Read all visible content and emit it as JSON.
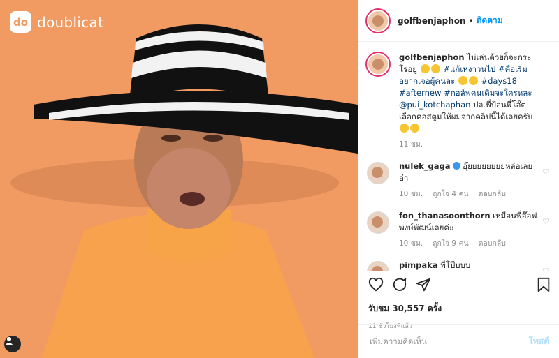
{
  "brand": {
    "logo_text": "do",
    "name": "doublicat"
  },
  "header": {
    "username": "golfbenjaphon",
    "follow": "ติดตาม",
    "separator": "•"
  },
  "caption": {
    "username": "golfbenjaphon",
    "part1": "ไม่เล่นด้วยก็จะกระโรอยู่",
    "hashtag1": "#แก้เหงาวนไป",
    "hashtag2": "#คือเริ่มอยากเจอผู้คนละ",
    "hashtag3": "#days18",
    "hashtag4": "#afternew",
    "hashtag5": "#กอล์ฟคนเดิมจะใครหละ",
    "mention": "@pui_kotchaphan",
    "part2": "ปล.พี่ป้อนพี่โอ๊ตเลือกคอสตูมให้ผมจากคลิปนี้ได้เลยครับ",
    "time": "11 ชม."
  },
  "comments": [
    {
      "username": "nulek_gaga",
      "text": "อุ๊ยยยยยยยยหล่อเลยอ่า",
      "time": "10 ชม.",
      "likes": "ถูกใจ 4 คน",
      "reply": "ตอบกลับ"
    },
    {
      "username": "fon_thanasoonthorn",
      "text": "เหมือนพี่อ๊อฟพงษ์พัฒน์เลยค่ะ",
      "time": "10 ชม.",
      "likes": "ถูกใจ 9 คน",
      "reply": "ตอบกลับ"
    },
    {
      "username": "pimpaka",
      "text": "พี่โป๊บบบ"
    }
  ],
  "likes": "รับชม 30,557 ครั้ง",
  "time_ago": "11 ชั่วโมงที่แล้ว",
  "add_comment": {
    "placeholder": "เพิ่มความคิดเห็น",
    "post": "โพสต์"
  },
  "icons": [
    "heart-icon",
    "comment-icon",
    "share-icon",
    "bookmark-icon",
    "user-tag-icon"
  ],
  "colors": {
    "background": "#f19a62",
    "link": "#0095f6",
    "hashtag": "#00376b",
    "muted": "#8e8e8e"
  }
}
